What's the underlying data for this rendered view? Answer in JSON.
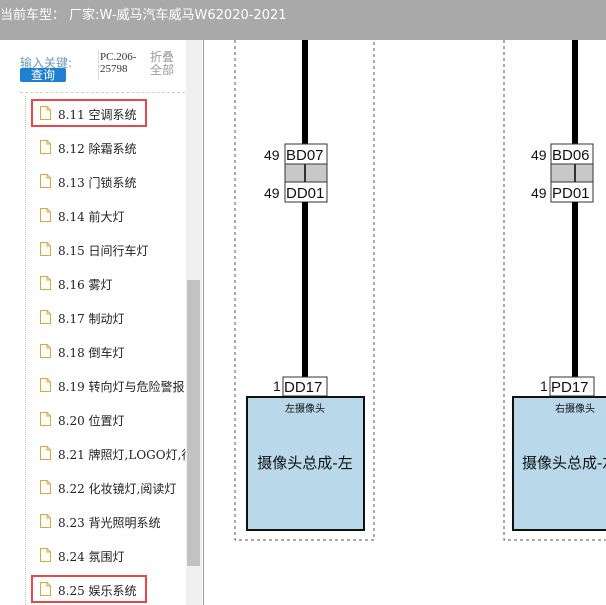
{
  "window": {
    "title": "当前车型：  厂家:W-威马汽车威马W62020-2021"
  },
  "sidebar": {
    "search_label": "输入关键:",
    "search_button": "查询",
    "pc_code": "PC.206-25798",
    "fold_all": "折叠全部",
    "items": [
      {
        "label": "8.11 空调系统",
        "highlighted": true
      },
      {
        "label": "8.12 除霜系统",
        "highlighted": false
      },
      {
        "label": "8.13 门锁系统",
        "highlighted": false
      },
      {
        "label": "8.14 前大灯",
        "highlighted": false
      },
      {
        "label": "8.15 日间行车灯",
        "highlighted": false
      },
      {
        "label": "8.16 雾灯",
        "highlighted": false
      },
      {
        "label": "8.17 制动灯",
        "highlighted": false
      },
      {
        "label": "8.18 倒车灯",
        "highlighted": false
      },
      {
        "label": "8.19 转向灯与危险警报",
        "highlighted": false
      },
      {
        "label": "8.20 位置灯",
        "highlighted": false
      },
      {
        "label": "8.21 牌照灯,LOGO灯,行",
        "highlighted": false
      },
      {
        "label": "8.22 化妆镜灯,阅读灯",
        "highlighted": false
      },
      {
        "label": "8.23 背光照明系统",
        "highlighted": false
      },
      {
        "label": "8.24 氛围灯",
        "highlighted": false
      },
      {
        "label": "8.25 娱乐系统",
        "highlighted": true
      }
    ]
  },
  "diagram": {
    "left": {
      "top_pin": "49",
      "top_connector": "BD07",
      "mid_pin": "49",
      "mid_connector": "DD01",
      "bottom_pin": "1",
      "bottom_connector": "DD17",
      "component_caption": "左摄像头",
      "component_name": "摄像头总成-左"
    },
    "right": {
      "top_pin": "49",
      "top_connector": "BD06",
      "mid_pin": "49",
      "mid_connector": "PD01",
      "bottom_pin": "1",
      "bottom_connector": "PD17",
      "component_caption": "右摄像头",
      "component_name": "摄像头总成-左"
    },
    "colors": {
      "component_fill": "#b9d9ea",
      "wire": "#000000",
      "connector_border": "#333333"
    }
  }
}
